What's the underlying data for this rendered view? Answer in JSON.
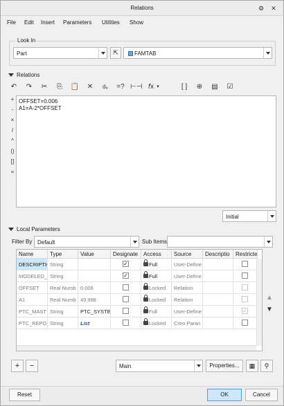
{
  "window": {
    "title": "Relations"
  },
  "menu": [
    "File",
    "Edit",
    "Insert",
    "Parameters",
    "Utilities",
    "Show"
  ],
  "look_in": {
    "label": "Look In",
    "type_value": "Part",
    "model_value": "FAMTAB"
  },
  "relations": {
    "heading": "Relations",
    "lines": [
      "OFFSET=0.006",
      "A1=A-2*OFFSET"
    ],
    "operators": [
      "+",
      "-",
      "×",
      "/",
      "^",
      "()",
      "[]",
      "="
    ],
    "sort_value": "Initial"
  },
  "local_params": {
    "heading": "Local Parameters",
    "filter_label": "Filter By",
    "filter_value": "Default",
    "sub_items_label": "Sub Items",
    "columns": [
      "Name",
      "Type",
      "Value",
      "Designate",
      "Access",
      "Source",
      "Descriptio",
      "Restricted"
    ],
    "rows": [
      {
        "name": "DESCRIPTIO",
        "type": "String",
        "value": "",
        "designate": "✓",
        "access": "Full",
        "source": "User-Define",
        "restricted": ""
      },
      {
        "name": "MODELED_",
        "type": "String",
        "value": "",
        "designate": "✓",
        "access": "Full",
        "source": "User-Define",
        "restricted": ""
      },
      {
        "name": "OFFSET",
        "type": "Real Numb",
        "value": "0.006",
        "designate": "",
        "access": "Locked",
        "source": "Relation",
        "restricted": ""
      },
      {
        "name": "A1",
        "type": "Real Numb",
        "value": "49.988",
        "designate": "",
        "access": "Locked",
        "source": "Relation",
        "restricted": ""
      },
      {
        "name": "PTC_MAST",
        "type": "String",
        "value": "PTC_SYSTE",
        "designate": "",
        "access": "Full",
        "source": "User-Define",
        "restricted": "✓"
      },
      {
        "name": "PTC_REPOI",
        "type": "String",
        "value": "List",
        "designate": "",
        "access": "Locked",
        "source": "Creo Paran",
        "restricted": ""
      }
    ],
    "view_value": "Main",
    "properties_label": "Properties..."
  },
  "footer": {
    "reset": "Reset",
    "ok": "OK",
    "cancel": "Cancel"
  },
  "colors": {
    "accent": "#4a9fd8",
    "selection": "#cde8fb"
  }
}
